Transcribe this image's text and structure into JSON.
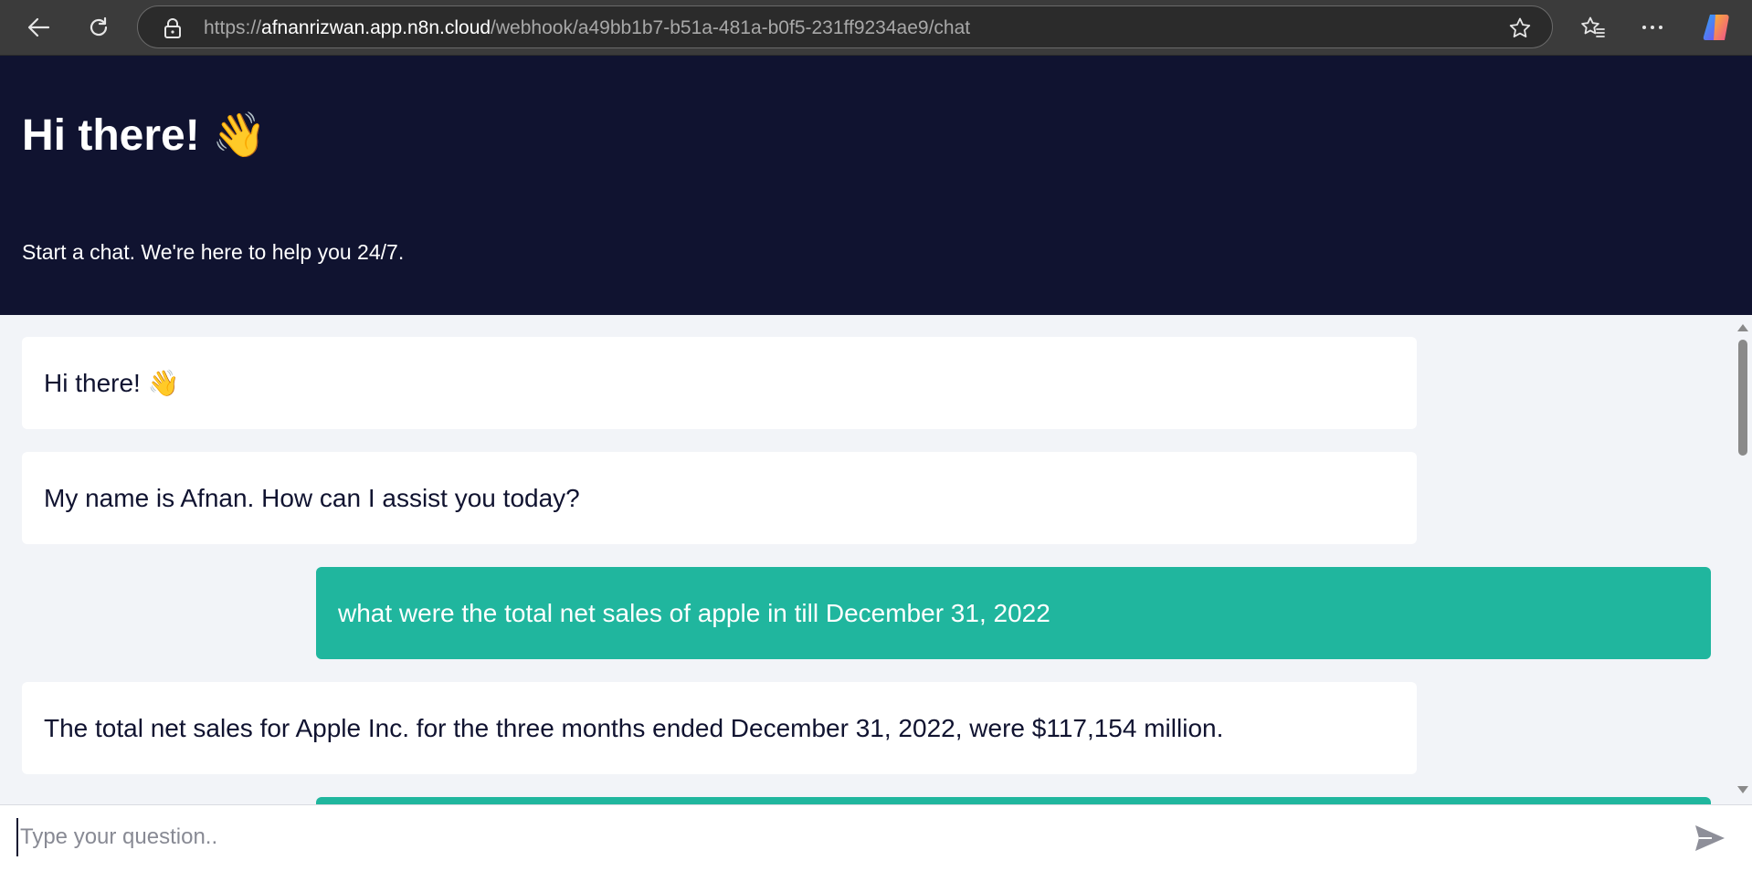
{
  "browser": {
    "url_scheme": "https://",
    "url_host": "afnanrizwan.app.n8n.cloud",
    "url_path": "/webhook/a49bb1b7-b51a-481a-b0f5-231ff9234ae9/chat",
    "icons": [
      "back-arrow-icon",
      "refresh-icon",
      "lock-icon",
      "favorite-star-icon",
      "favorites-list-icon",
      "more-options-icon",
      "copilot-icon"
    ]
  },
  "header": {
    "title": "Hi there! 👋",
    "subtitle": "Start a chat. We're here to help you 24/7."
  },
  "messages": [
    {
      "role": "bot",
      "text": "Hi there! 👋"
    },
    {
      "role": "bot",
      "text": "My name is Afnan. How can I assist you today?"
    },
    {
      "role": "user",
      "text": "what were the total net sales of apple in till December 31, 2022"
    },
    {
      "role": "bot",
      "text": "The total net sales for Apple Inc. for the three months ended December 31, 2022, were $117,154 million."
    },
    {
      "role": "user",
      "text": ""
    }
  ],
  "input": {
    "placeholder": "Type your question..",
    "value": ""
  },
  "colors": {
    "header_bg": "#101330",
    "user_bubble": "#20b69e",
    "bot_bubble": "#ffffff",
    "page_bg": "#f2f4f8"
  }
}
